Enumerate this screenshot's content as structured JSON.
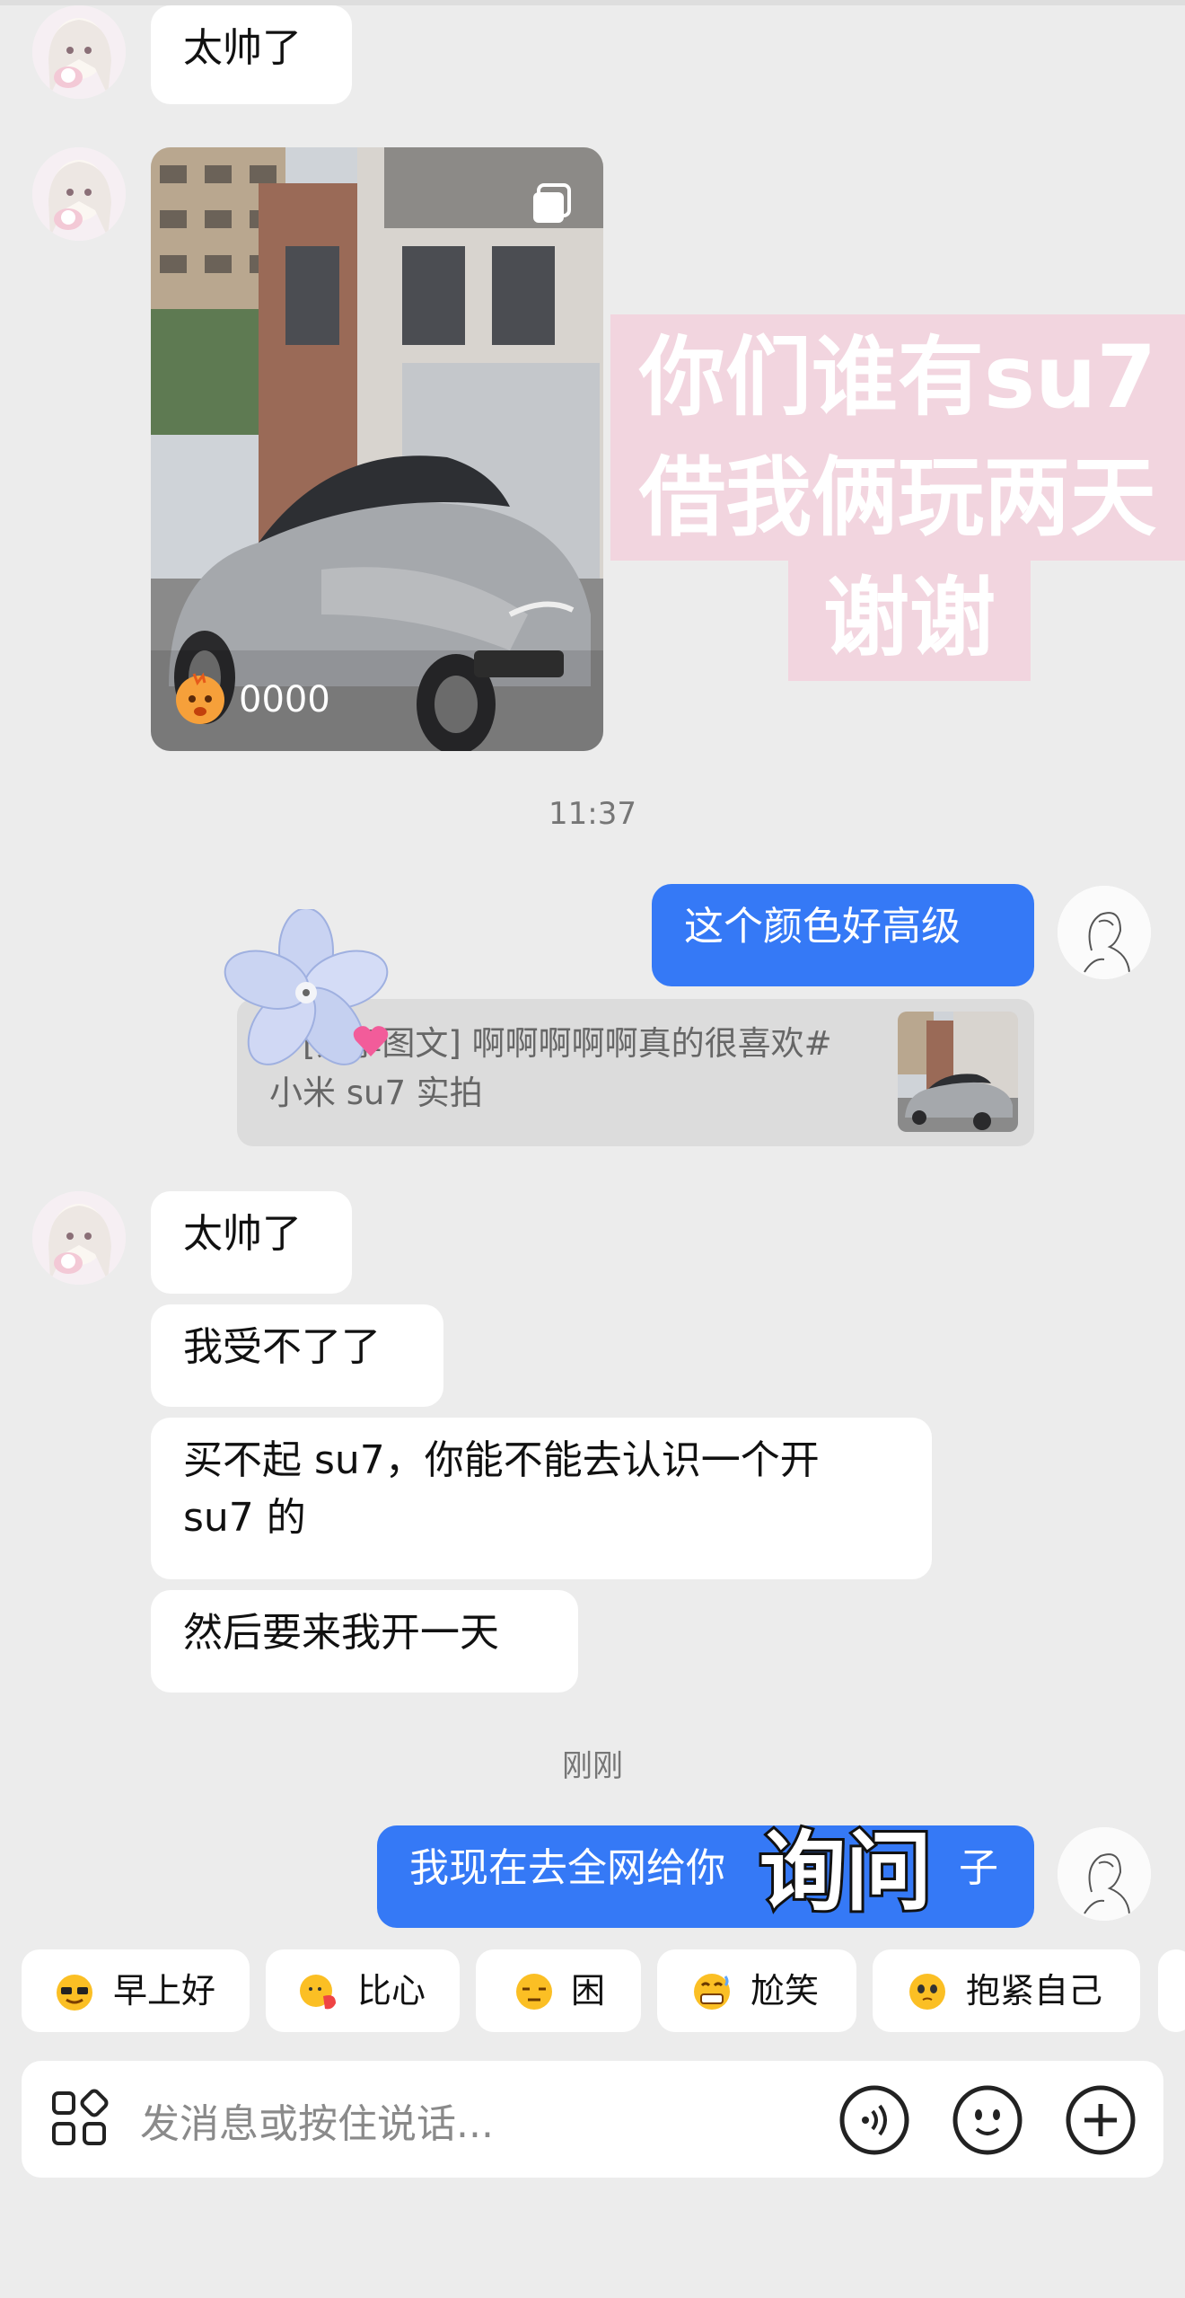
{
  "messages": {
    "first_reply": "太帅了",
    "photo_count": "0000",
    "sticker_lines": [
      "你们谁有su7",
      "借我俩玩两天",
      "谢谢"
    ],
    "time_1": "11:37",
    "me_1": "这个颜色好高级",
    "quote_text": "：[分享图文] 啊啊啊啊啊真的很喜欢#小米 su7 实拍",
    "r1": "太帅了",
    "r2": "我受不了了",
    "r3": "买不起 su7，你能不能去认识一个开 su7 的",
    "r4": "然后要来我开一天",
    "time_2": "刚刚",
    "me_2": "我现在去全网给你",
    "me_2_tail": "子",
    "caption_overlay": "询问"
  },
  "quick_replies": [
    {
      "label": "早上好",
      "icon": "sun-glasses-emoji-icon"
    },
    {
      "label": "比心",
      "icon": "finger-heart-emoji-icon"
    },
    {
      "label": "困",
      "icon": "sleepy-face-emoji-icon"
    },
    {
      "label": "尬笑",
      "icon": "awkward-grin-emoji-icon"
    },
    {
      "label": "抱紧自己",
      "icon": "self-hug-emoji-icon"
    }
  ],
  "input": {
    "placeholder": "发消息或按住说话...",
    "left_icon": "apps-grid-icon",
    "buttons": [
      "voice-icon",
      "emoji-icon",
      "plus-icon"
    ]
  },
  "colors": {
    "background": "#ececec",
    "my_bubble": "#3579f6",
    "sticker_bg": "#f2d5df"
  }
}
